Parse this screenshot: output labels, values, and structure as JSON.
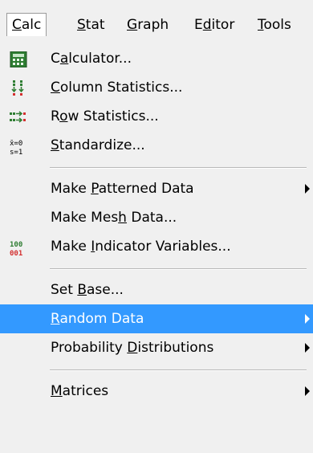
{
  "menubar": [
    {
      "id": "calc",
      "label": "Calc",
      "mn": "C",
      "open": true
    },
    {
      "id": "stat",
      "label": "Stat",
      "mn": "S"
    },
    {
      "id": "graph",
      "label": "Graph",
      "mn": "G"
    },
    {
      "id": "editor",
      "label": "Editor",
      "mn": "d"
    },
    {
      "id": "tools",
      "label": "Tools",
      "mn": "T"
    }
  ],
  "menu": [
    {
      "type": "item",
      "id": "calculator",
      "label": "Calculator...",
      "mn": "a",
      "icon": "calculator-icon"
    },
    {
      "type": "item",
      "id": "column-statistics",
      "label": "Column Statistics...",
      "mn": "C",
      "icon": "column-statistics-icon"
    },
    {
      "type": "item",
      "id": "row-statistics",
      "label": "Row Statistics...",
      "mn": "o",
      "icon": "row-statistics-icon"
    },
    {
      "type": "item",
      "id": "standardize",
      "label": "Standardize...",
      "mn": "S",
      "icon": "standardize-icon",
      "icon_text_top": "x̄=0",
      "icon_text_bottom": "s=1"
    },
    {
      "type": "separator"
    },
    {
      "type": "item",
      "id": "make-patterned-data",
      "label": "Make Patterned Data",
      "mn": "P",
      "submenu": true
    },
    {
      "type": "item",
      "id": "make-mesh-data",
      "label": "Make Mesh Data...",
      "mn": "h"
    },
    {
      "type": "item",
      "id": "make-indicator-variables",
      "label": "Make Indicator Variables...",
      "mn": "I",
      "icon": "indicator-variables-icon",
      "icon_text_top": "100",
      "icon_text_bottom": "001"
    },
    {
      "type": "separator"
    },
    {
      "type": "item",
      "id": "set-base",
      "label": "Set Base...",
      "mn": "B"
    },
    {
      "type": "item",
      "id": "random-data",
      "label": "Random Data",
      "mn": "R",
      "submenu": true,
      "highlighted": true
    },
    {
      "type": "item",
      "id": "probability-distributions",
      "label": "Probability Distributions",
      "mn": "D",
      "submenu": true
    },
    {
      "type": "separator"
    },
    {
      "type": "item",
      "id": "matrices",
      "label": "Matrices",
      "mn": "M",
      "submenu": true
    }
  ],
  "colors": {
    "highlight": "#3399ff",
    "menu_bg": "#f0f0f0",
    "calc_icon": "#2e7d32",
    "col_stats_icon": "#d32f2f"
  }
}
